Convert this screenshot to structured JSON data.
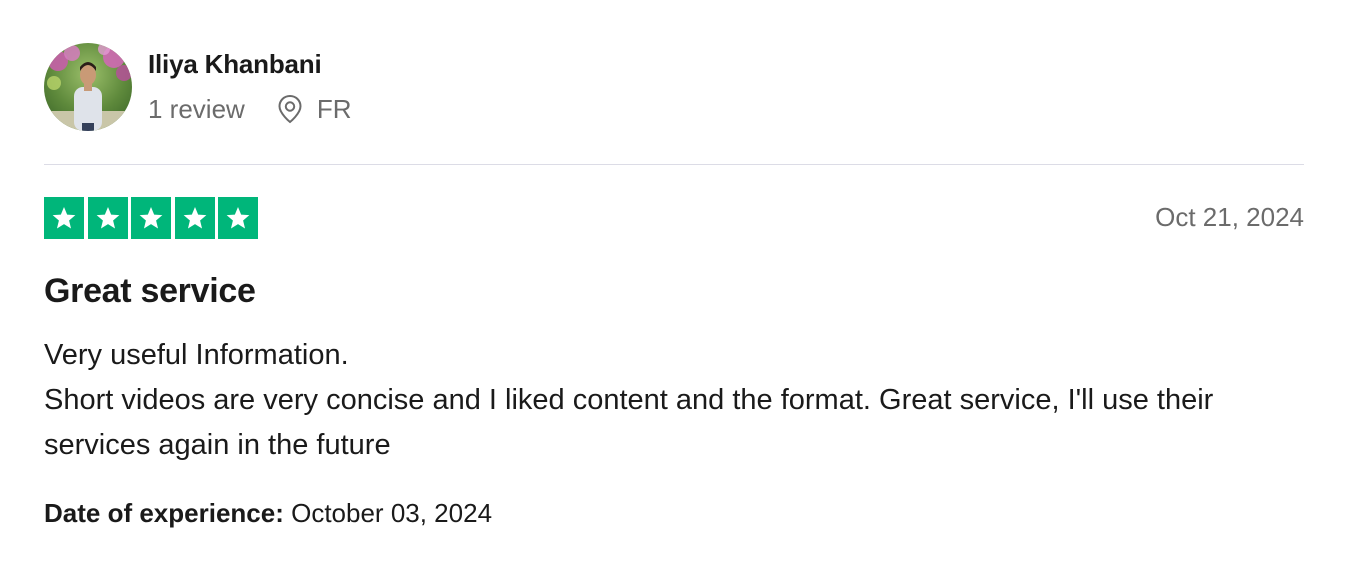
{
  "reviewer": {
    "name": "Iliya Khanbani",
    "review_count": "1 review",
    "location": "FR",
    "avatar_icon": "profile-photo"
  },
  "rating": {
    "value": 5,
    "max": 5,
    "color": "#00b67a"
  },
  "review": {
    "date": "Oct 21, 2024",
    "title": "Great service",
    "body_lines": [
      "Very useful Information.",
      "Short videos are very concise and I liked content and the format. Great service, I'll use their services again in the future"
    ]
  },
  "experience": {
    "label": "Date of experience:",
    "date": "October 03, 2024"
  },
  "colors": {
    "star_green": "#00b67a",
    "muted_text": "#6b6b6b",
    "divider": "#dcdce6"
  }
}
